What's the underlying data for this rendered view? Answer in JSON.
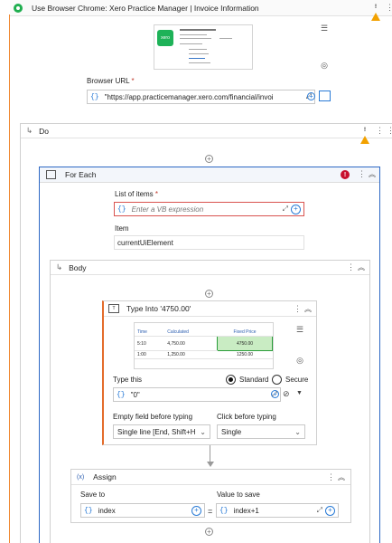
{
  "browser_scope": {
    "title": "Use Browser Chrome: Xero Practice Manager | Invoice Information",
    "url_label": "Browser URL",
    "required_mark": "*",
    "url_value": "\"https://app.practicemanager.xero.com/financial/invoi",
    "brace_glyph": "{}",
    "logo_text": "xero"
  },
  "do_block": {
    "title": "Do"
  },
  "for_each": {
    "title": "For Each",
    "list_label": "List of items",
    "required_mark": "*",
    "list_placeholder": "Enter a VB expression",
    "item_label": "Item",
    "item_value": "currentUiElement"
  },
  "body_block": {
    "title": "Body"
  },
  "type_into": {
    "title": "Type Into '4750.00'",
    "preview": {
      "headers": [
        "Time",
        "Calculated",
        "Fixed Price"
      ],
      "rows": [
        [
          "5:10",
          "4,750.00",
          "4750.00"
        ],
        [
          "1:00",
          "1,250.00",
          "1250.00"
        ]
      ]
    },
    "type_this_label": "Type this",
    "type_this_value": "\"0\"",
    "standard_label": "Standard",
    "secure_label": "Secure",
    "empty_field_label": "Empty field before typing",
    "empty_field_value": "Single line [End, Shift+H",
    "click_before_label": "Click before typing",
    "click_before_value": "Single"
  },
  "assign": {
    "badge": "(x)",
    "title": "Assign",
    "save_to_label": "Save to",
    "save_to_value": "index",
    "value_label": "Value to save",
    "value_value": "index+1",
    "equals": "="
  }
}
